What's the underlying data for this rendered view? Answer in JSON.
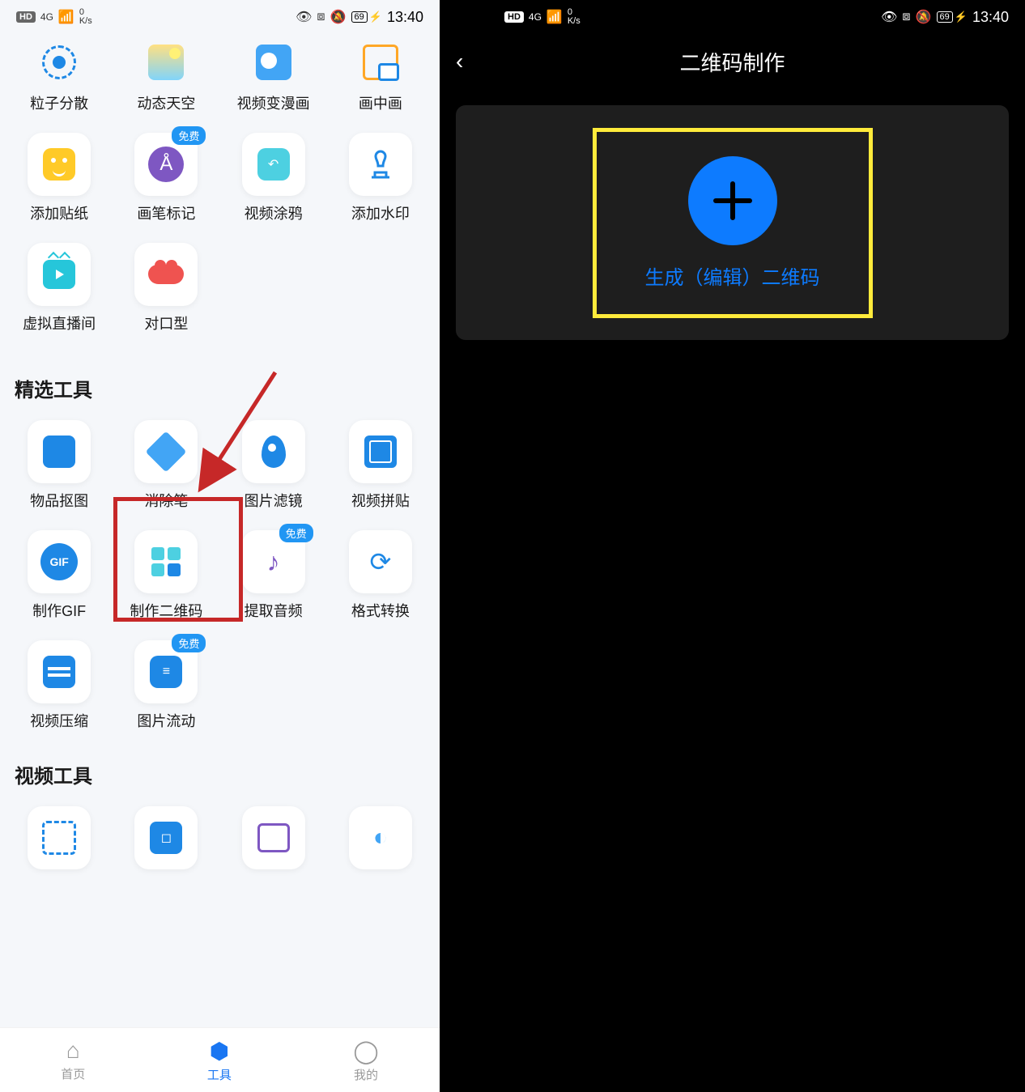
{
  "status": {
    "hd": "HD",
    "network": "4G",
    "speed_value": "0",
    "speed_unit": "K/s",
    "battery": "69",
    "time": "13:40"
  },
  "left": {
    "row1": [
      {
        "label": "粒子分散"
      },
      {
        "label": "动态天空"
      },
      {
        "label": "视频变漫画"
      },
      {
        "label": "画中画"
      }
    ],
    "row2": [
      {
        "label": "添加贴纸"
      },
      {
        "label": "画笔标记",
        "free": true
      },
      {
        "label": "视频涂鸦"
      },
      {
        "label": "添加水印"
      }
    ],
    "row3": [
      {
        "label": "虚拟直播间"
      },
      {
        "label": "对口型"
      }
    ],
    "section_featured": "精选工具",
    "featured1": [
      {
        "label": "物品抠图"
      },
      {
        "label": "消除笔"
      },
      {
        "label": "图片滤镜"
      },
      {
        "label": "视频拼贴"
      }
    ],
    "featured2": [
      {
        "label": "制作GIF"
      },
      {
        "label": "制作二维码"
      },
      {
        "label": "提取音频",
        "free": true
      },
      {
        "label": "格式转换"
      }
    ],
    "featured3": [
      {
        "label": "视频压缩"
      },
      {
        "label": "图片流动",
        "free": true
      }
    ],
    "section_video": "视频工具",
    "video_row": [
      {
        "label": ""
      },
      {
        "label": ""
      },
      {
        "label": ""
      },
      {
        "label": ""
      }
    ],
    "free_badge": "免费",
    "nav": [
      {
        "label": "首页"
      },
      {
        "label": "工具"
      },
      {
        "label": "我的"
      }
    ]
  },
  "right": {
    "title": "二维码制作",
    "create_label": "生成（编辑）二维码"
  }
}
